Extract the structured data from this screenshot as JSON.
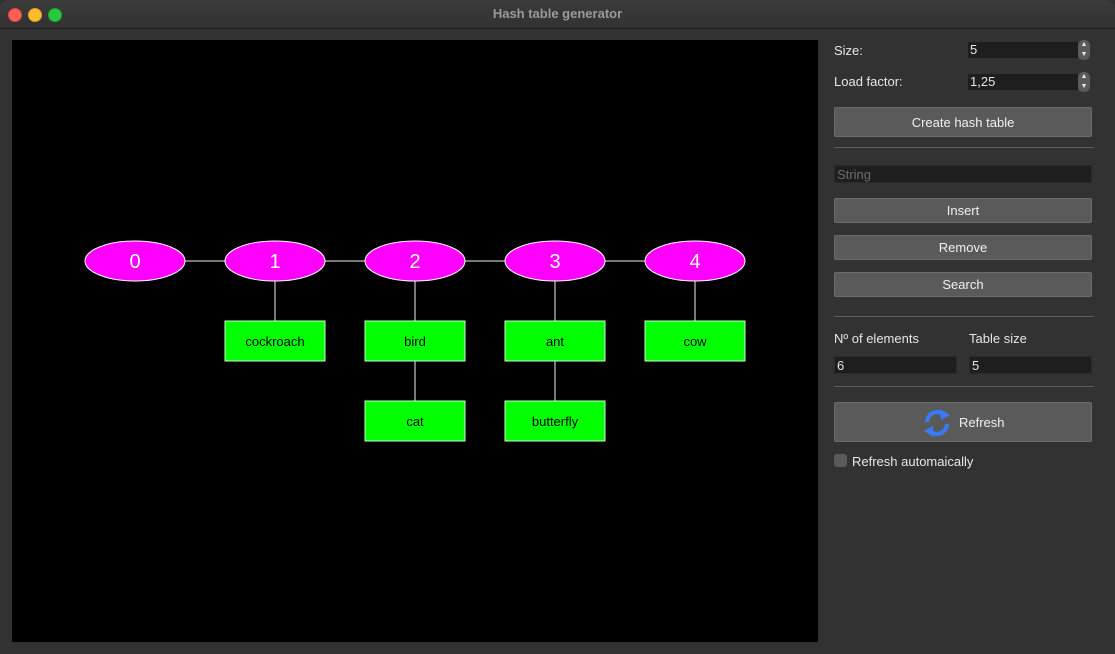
{
  "window": {
    "title": "Hash table generator"
  },
  "form": {
    "size_label": "Size:",
    "size_value": "5",
    "load_factor_label": "Load factor:",
    "load_factor_value": "1,25",
    "create_button": "Create hash table",
    "string_placeholder": "String",
    "insert_button": "Insert",
    "remove_button": "Remove",
    "search_button": "Search",
    "elements_label": "Nº of elements",
    "elements_value": "6",
    "table_size_label": "Table size",
    "table_size_value": "5",
    "refresh_button": "Refresh",
    "refresh_auto_label": "Refresh automaically",
    "refresh_auto_checked": false
  },
  "graph": {
    "buckets": [
      {
        "label": "0",
        "items": []
      },
      {
        "label": "1",
        "items": [
          "cockroach"
        ]
      },
      {
        "label": "2",
        "items": [
          "bird",
          "cat"
        ]
      },
      {
        "label": "3",
        "items": [
          "ant",
          "butterfly"
        ]
      },
      {
        "label": "4",
        "items": [
          "cow"
        ]
      }
    ],
    "colors": {
      "bucket": "#ff00ff",
      "node": "#00ff00",
      "edge": "#a0a0a0",
      "background": "#000000"
    }
  },
  "icons": {
    "refresh": "refresh-arrows-icon"
  }
}
